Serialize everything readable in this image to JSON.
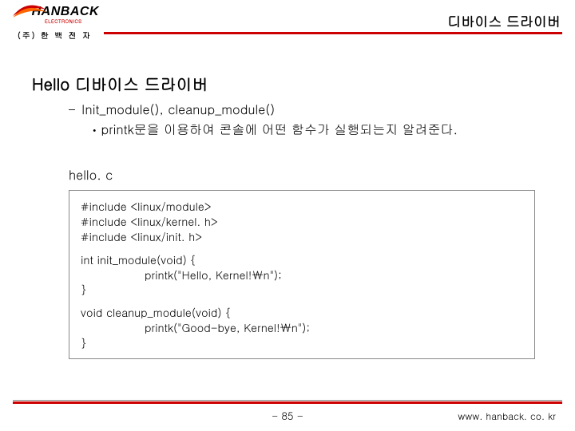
{
  "header": {
    "logo": {
      "brand": "HANBACK",
      "sub": "ELECTRONICS",
      "kr": "(주) 한 백 전 자"
    },
    "title": "디바이스 드라이버"
  },
  "content": {
    "heading": "Hello 디바이스 드라이버",
    "bullet1": "Init_module(), cleanup_module()",
    "bullet2": "printk문을 이용하여 콘솔에 어떤 함수가 실행되는지 알려준다.",
    "file_label": "hello. c",
    "code": {
      "inc1": "#include <linux/module>",
      "inc2": "#include <linux/kernel. h>",
      "inc3": "#include <linux/init. h>",
      "fn1_sig": "int init_module(void) {",
      "fn1_body": "printk(\"Hello, Kernel!￦n\");",
      "fn1_end": "}",
      "fn2_sig": "void cleanup_module(void) {",
      "fn2_body": "printk(\"Good-bye, Kernel!￦n\");",
      "fn2_end": "}"
    }
  },
  "footer": {
    "page": "- 85 -",
    "site": "www. hanback. co. kr"
  }
}
